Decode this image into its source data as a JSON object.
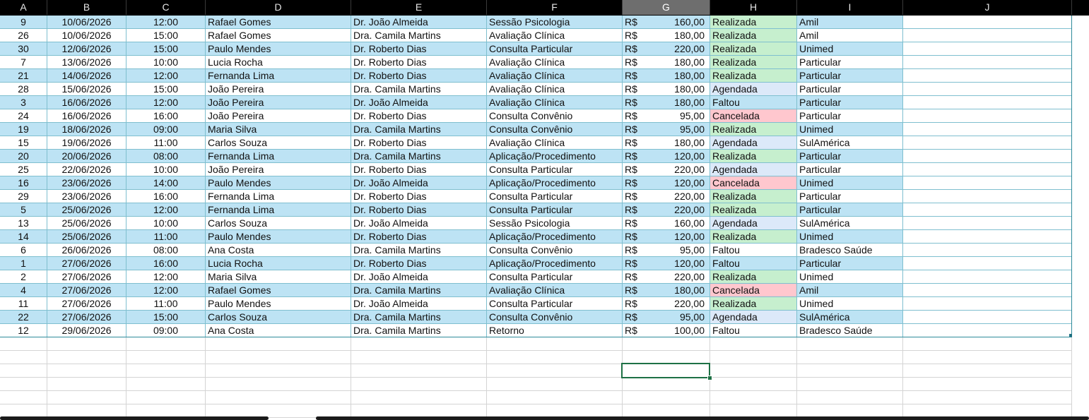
{
  "columns": [
    "A",
    "B",
    "C",
    "D",
    "E",
    "F",
    "G",
    "H",
    "I",
    "J"
  ],
  "selected_column": "G",
  "currency_symbol": "R$",
  "rows": [
    {
      "id": "9",
      "date": "10/06/2026",
      "time": "12:00",
      "patient": "Rafael Gomes",
      "doctor": "Dr. João Almeida",
      "service": "Sessão Psicologia",
      "amount": "160,00",
      "status": "Realizada",
      "insurer": "Amil"
    },
    {
      "id": "26",
      "date": "10/06/2026",
      "time": "15:00",
      "patient": "Rafael Gomes",
      "doctor": "Dra. Camila Martins",
      "service": "Avaliação Clínica",
      "amount": "180,00",
      "status": "Realizada",
      "insurer": "Amil"
    },
    {
      "id": "30",
      "date": "12/06/2026",
      "time": "15:00",
      "patient": "Paulo Mendes",
      "doctor": "Dr. Roberto Dias",
      "service": "Consulta Particular",
      "amount": "220,00",
      "status": "Realizada",
      "insurer": "Unimed"
    },
    {
      "id": "7",
      "date": "13/06/2026",
      "time": "10:00",
      "patient": "Lucia Rocha",
      "doctor": "Dr. Roberto Dias",
      "service": "Avaliação Clínica",
      "amount": "180,00",
      "status": "Realizada",
      "insurer": "Particular"
    },
    {
      "id": "21",
      "date": "14/06/2026",
      "time": "12:00",
      "patient": "Fernanda Lima",
      "doctor": "Dr. Roberto Dias",
      "service": "Avaliação Clínica",
      "amount": "180,00",
      "status": "Realizada",
      "insurer": "Particular"
    },
    {
      "id": "28",
      "date": "15/06/2026",
      "time": "15:00",
      "patient": "João Pereira",
      "doctor": "Dra. Camila Martins",
      "service": "Avaliação Clínica",
      "amount": "180,00",
      "status": "Agendada",
      "insurer": "Particular"
    },
    {
      "id": "3",
      "date": "16/06/2026",
      "time": "12:00",
      "patient": "João Pereira",
      "doctor": "Dr. João Almeida",
      "service": "Avaliação Clínica",
      "amount": "180,00",
      "status": "Faltou",
      "insurer": "Particular"
    },
    {
      "id": "24",
      "date": "16/06/2026",
      "time": "16:00",
      "patient": "João Pereira",
      "doctor": "Dr. Roberto Dias",
      "service": "Consulta Convênio",
      "amount": "95,00",
      "status": "Cancelada",
      "insurer": "Particular"
    },
    {
      "id": "19",
      "date": "18/06/2026",
      "time": "09:00",
      "patient": "Maria Silva",
      "doctor": "Dra. Camila Martins",
      "service": "Consulta Convênio",
      "amount": "95,00",
      "status": "Realizada",
      "insurer": "Unimed"
    },
    {
      "id": "15",
      "date": "19/06/2026",
      "time": "11:00",
      "patient": "Carlos Souza",
      "doctor": "Dr. Roberto Dias",
      "service": "Avaliação Clínica",
      "amount": "180,00",
      "status": "Agendada",
      "insurer": "SulAmérica"
    },
    {
      "id": "20",
      "date": "20/06/2026",
      "time": "08:00",
      "patient": "Fernanda Lima",
      "doctor": "Dra. Camila Martins",
      "service": "Aplicação/Procedimento",
      "amount": "120,00",
      "status": "Realizada",
      "insurer": "Particular"
    },
    {
      "id": "25",
      "date": "22/06/2026",
      "time": "10:00",
      "patient": "João Pereira",
      "doctor": "Dr. Roberto Dias",
      "service": "Consulta Particular",
      "amount": "220,00",
      "status": "Agendada",
      "insurer": "Particular"
    },
    {
      "id": "16",
      "date": "23/06/2026",
      "time": "14:00",
      "patient": "Paulo Mendes",
      "doctor": "Dr. João Almeida",
      "service": "Aplicação/Procedimento",
      "amount": "120,00",
      "status": "Cancelada",
      "insurer": "Unimed"
    },
    {
      "id": "29",
      "date": "23/06/2026",
      "time": "16:00",
      "patient": "Fernanda Lima",
      "doctor": "Dr. Roberto Dias",
      "service": "Consulta Particular",
      "amount": "220,00",
      "status": "Realizada",
      "insurer": "Particular"
    },
    {
      "id": "5",
      "date": "25/06/2026",
      "time": "12:00",
      "patient": "Fernanda Lima",
      "doctor": "Dr. Roberto Dias",
      "service": "Consulta Particular",
      "amount": "220,00",
      "status": "Realizada",
      "insurer": "Particular"
    },
    {
      "id": "13",
      "date": "25/06/2026",
      "time": "10:00",
      "patient": "Carlos Souza",
      "doctor": "Dr. João Almeida",
      "service": "Sessão Psicologia",
      "amount": "160,00",
      "status": "Agendada",
      "insurer": "SulAmérica"
    },
    {
      "id": "14",
      "date": "25/06/2026",
      "time": "11:00",
      "patient": "Paulo Mendes",
      "doctor": "Dr. Roberto Dias",
      "service": "Aplicação/Procedimento",
      "amount": "120,00",
      "status": "Realizada",
      "insurer": "Unimed"
    },
    {
      "id": "6",
      "date": "26/06/2026",
      "time": "08:00",
      "patient": "Ana Costa",
      "doctor": "Dra. Camila Martins",
      "service": "Consulta Convênio",
      "amount": "95,00",
      "status": "Faltou",
      "insurer": "Bradesco Saúde"
    },
    {
      "id": "1",
      "date": "27/06/2026",
      "time": "16:00",
      "patient": "Lucia Rocha",
      "doctor": "Dr. Roberto Dias",
      "service": "Aplicação/Procedimento",
      "amount": "120,00",
      "status": "Faltou",
      "insurer": "Particular"
    },
    {
      "id": "2",
      "date": "27/06/2026",
      "time": "12:00",
      "patient": "Maria Silva",
      "doctor": "Dr. João Almeida",
      "service": "Consulta Particular",
      "amount": "220,00",
      "status": "Realizada",
      "insurer": "Unimed"
    },
    {
      "id": "4",
      "date": "27/06/2026",
      "time": "12:00",
      "patient": "Rafael Gomes",
      "doctor": "Dra. Camila Martins",
      "service": "Avaliação Clínica",
      "amount": "180,00",
      "status": "Cancelada",
      "insurer": "Amil"
    },
    {
      "id": "11",
      "date": "27/06/2026",
      "time": "11:00",
      "patient": "Paulo Mendes",
      "doctor": "Dr. João Almeida",
      "service": "Consulta Particular",
      "amount": "220,00",
      "status": "Realizada",
      "insurer": "Unimed"
    },
    {
      "id": "22",
      "date": "27/06/2026",
      "time": "15:00",
      "patient": "Carlos Souza",
      "doctor": "Dra. Camila Martins",
      "service": "Consulta Convênio",
      "amount": "95,00",
      "status": "Agendada",
      "insurer": "SulAmérica"
    },
    {
      "id": "12",
      "date": "29/06/2026",
      "time": "09:00",
      "patient": "Ana Costa",
      "doctor": "Dra. Camila Martins",
      "service": "Retorno",
      "amount": "100,00",
      "status": "Faltou",
      "insurer": "Bradesco Saúde"
    }
  ],
  "colors": {
    "band": "#bde3f4",
    "realizada": "#c6efce",
    "agendada": "#dce9f9",
    "cancelada": "#ffc7ce",
    "table_border": "#2e8b9a",
    "active_cell": "#1e7145"
  }
}
